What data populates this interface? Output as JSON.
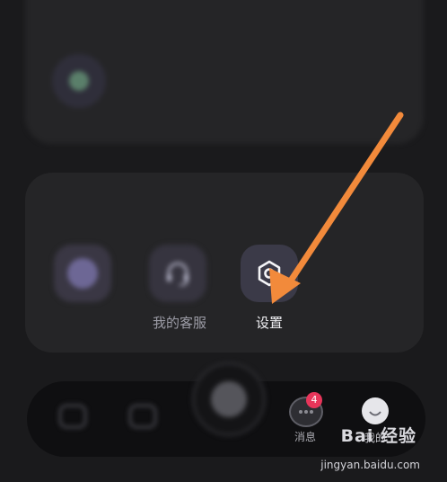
{
  "top_card": {
    "item_label": ""
  },
  "section": {
    "title": "",
    "items": [
      {
        "label": "",
        "icon": "service-bubble-icon"
      },
      {
        "label": "我的客服",
        "icon": "headset-icon"
      },
      {
        "label": "设置",
        "icon": "gear-hexagon-icon"
      }
    ]
  },
  "tabbar": {
    "messages_label": "消息",
    "messages_badge": "4",
    "me_label": "我的"
  },
  "watermark": {
    "brand": "Bai 经验",
    "url": "jingyan.baidu.com"
  },
  "colors": {
    "arrow": "#f28a3b",
    "badge": "#e8355a",
    "background": "#1a1a1c"
  }
}
